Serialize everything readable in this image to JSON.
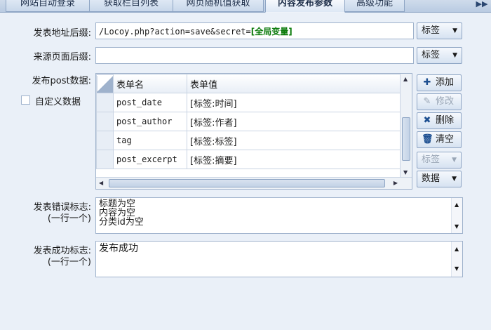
{
  "tabs": [
    {
      "label": "网站自动登录"
    },
    {
      "label": "获取栏目列表"
    },
    {
      "label": "网页随机值获取"
    },
    {
      "label": "内容发布参数"
    },
    {
      "label": "高级功能"
    }
  ],
  "form": {
    "post_url_label": "发表地址后缀:",
    "post_url_value": "/Locoy.php?action=save&secret=",
    "post_url_var": "[全局变量]",
    "tag_button": "标签",
    "source_page_label": "来源页面后缀:",
    "source_page_value": "",
    "source_tag_button": "标签",
    "post_data_label": "发布post数据:",
    "custom_data_label": "自定义数据"
  },
  "grid": {
    "columns": [
      "表单名",
      "表单值"
    ],
    "rows": [
      {
        "name": "post_date",
        "value": "[标签:时间]"
      },
      {
        "name": "post_author",
        "value": "[标签:作者]"
      },
      {
        "name": "tag",
        "value": "[标签:标签]"
      },
      {
        "name": "post_excerpt",
        "value": "[标签:摘要]"
      }
    ]
  },
  "side_buttons": {
    "add": "添加",
    "edit": "修改",
    "delete": "删除",
    "clear": "清空",
    "tag": "标签",
    "data": "数据"
  },
  "error_section": {
    "label": "发表错误标志:",
    "hint": "(一行一个)",
    "lines": [
      "标题为空",
      "内容为空",
      "分类id为空"
    ]
  },
  "success_section": {
    "label": "发表成功标志:",
    "hint": "(一行一个)",
    "lines": [
      "发布成功"
    ]
  }
}
